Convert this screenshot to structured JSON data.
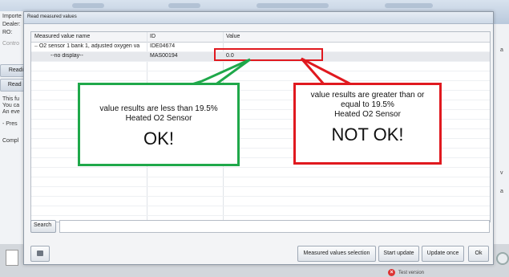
{
  "background": {
    "left_labels": [
      "Importe",
      "Dealer:",
      "RO:",
      "Contro"
    ],
    "left_buttons": [
      "Readi",
      "Read i"
    ],
    "left_text": [
      "This fu",
      "You ca",
      "An eve",
      "- Pres",
      "Compl"
    ],
    "right_glyphs": [
      "a",
      "v",
      "a"
    ]
  },
  "dialog": {
    "title": "Read measured values",
    "columns": {
      "name": "Measured value name",
      "id": "ID",
      "value": "Value"
    },
    "rows": [
      {
        "name": "O2 sensor 1 bank 1, adjusted oxygen va",
        "id": "IDE04674",
        "value": ""
      },
      {
        "name": "--no display--",
        "id": "MAS00194",
        "value": "0.0"
      }
    ],
    "search_label": "Search",
    "search_value": "",
    "buttons": {
      "selection": "Measured values selection",
      "start": "Start update",
      "once": "Update once",
      "ok": "Ok"
    }
  },
  "annotations": {
    "left": {
      "line1": "value results are less than 19.5%",
      "line2": "Heated O2 Sensor",
      "verdict": "OK!"
    },
    "right": {
      "line1": "value results are greater than or",
      "line2": "equal to 19.5%",
      "line3": "Heated O2 Sensor",
      "verdict": "NOT OK!"
    }
  },
  "status": {
    "test_version": "Test version"
  },
  "colors": {
    "ok": "#1fa84a",
    "not_ok": "#e0191f"
  }
}
